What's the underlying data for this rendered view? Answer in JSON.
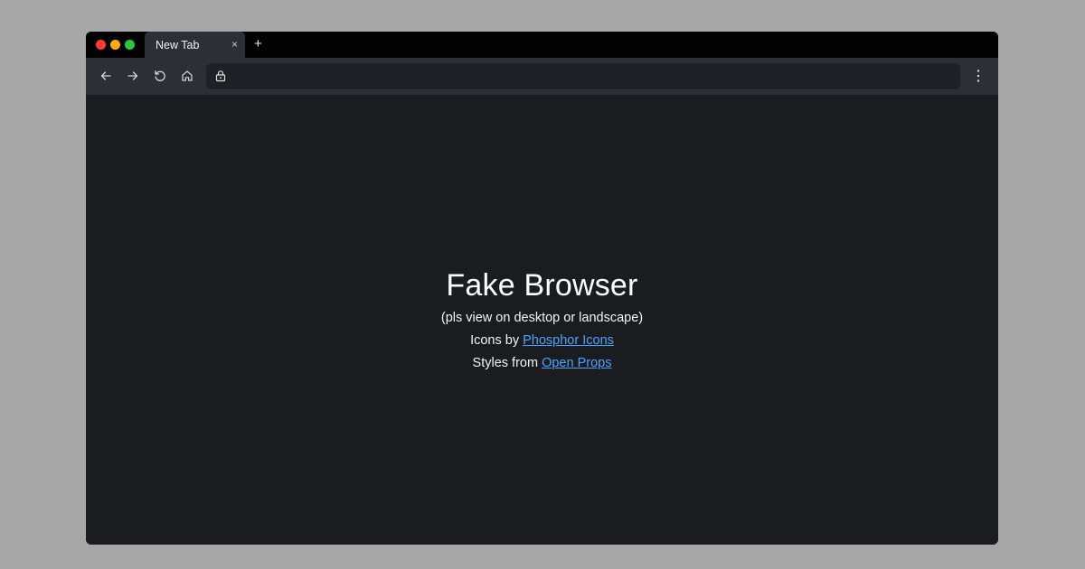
{
  "tab": {
    "title": "New Tab",
    "close_glyph": "×"
  },
  "new_tab_glyph": "+",
  "toolbar": {
    "back_icon": "arrow-left-icon",
    "forward_icon": "arrow-right-icon",
    "reload_icon": "reload-icon",
    "home_icon": "home-icon",
    "address": {
      "value": "",
      "lock_icon": "lock-icon"
    },
    "menu_icon": "vertical-dots-icon"
  },
  "content": {
    "title": "Fake Browser",
    "subtitle": "(pls view on desktop or landscape)",
    "icons_prefix": "Icons by",
    "icons_link": "Phosphor Icons",
    "styles_prefix": "Styles from",
    "styles_link": "Open Props"
  },
  "colors": {
    "background": "#a7a7a7",
    "titlebar": "#020203",
    "tab_active": "#2c2f36",
    "toolbar": "#2c2f36",
    "address_bar": "#1f2126",
    "content_bg": "#1b1c20",
    "link": "#4da3ff",
    "traffic_red": "#ff3b30",
    "traffic_yellow": "#ffab0a",
    "traffic_green": "#28c840"
  }
}
